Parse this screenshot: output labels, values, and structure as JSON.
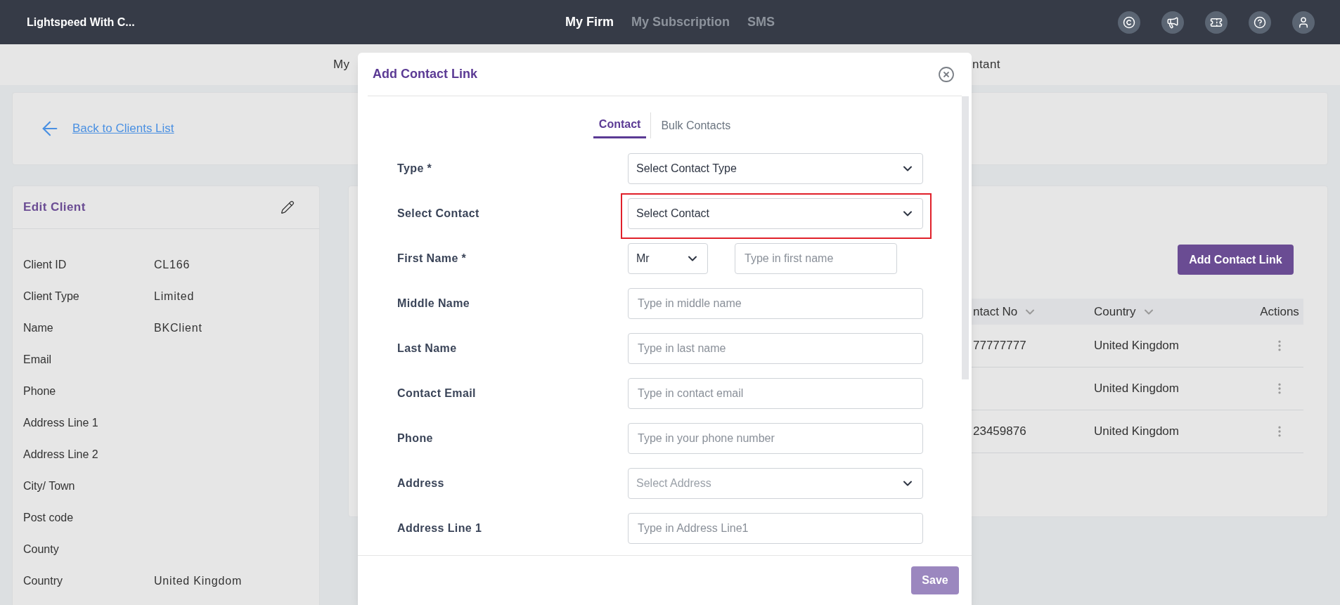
{
  "top_bar": {
    "brand": "Lightspeed With C...",
    "nav": [
      {
        "label": "My Firm",
        "selected": true
      },
      {
        "label": "My Subscription",
        "selected": false
      },
      {
        "label": "SMS",
        "selected": false
      }
    ]
  },
  "sub_nav": {
    "texts": [
      "My",
      "ntant"
    ]
  },
  "back_link": "Back to Clients List",
  "client_panel": {
    "title": "Edit Client",
    "fields": [
      {
        "label": "Client ID",
        "value": "CL166"
      },
      {
        "label": "Client Type",
        "value": "Limited"
      },
      {
        "label": "Name",
        "value": "BKClient"
      },
      {
        "label": "Email"
      },
      {
        "label": "Phone"
      },
      {
        "label": "Address Line 1"
      },
      {
        "label": "Address Line 2"
      },
      {
        "label": "City/ Town"
      },
      {
        "label": "Post code"
      },
      {
        "label": "County"
      },
      {
        "label": "Country",
        "value": "United Kingdom"
      }
    ]
  },
  "contacts_panel": {
    "add_button": "Add Contact Link",
    "columns": [
      {
        "label": "ntact No",
        "sortable": true
      },
      {
        "label": "Country",
        "sortable": true
      },
      {
        "label": "Actions",
        "sortable": false
      }
    ],
    "rows": [
      [
        "77777777",
        "United Kingdom"
      ],
      [
        "",
        "United Kingdom"
      ],
      [
        "23459876",
        "United Kingdom"
      ]
    ]
  },
  "modal": {
    "title": "Add Contact Link",
    "tabs": [
      {
        "label": "Contact",
        "selected": true
      },
      {
        "label": "Bulk Contacts",
        "selected": false
      }
    ],
    "fields": [
      {
        "label": "Type *",
        "kind": "select",
        "value": "Select Contact Type",
        "highlighted": false
      },
      {
        "label": "Select Contact",
        "kind": "select",
        "value": "Select Contact",
        "highlighted": true
      },
      {
        "label": "First Name *",
        "kind": "name",
        "title": "Mr",
        "placeholder": "Type in first name",
        "highlighted": false
      },
      {
        "label": "Middle Name",
        "kind": "input",
        "placeholder": "Type in middle name",
        "highlighted": false
      },
      {
        "label": "Last Name",
        "kind": "input",
        "placeholder": "Type in last name",
        "highlighted": false
      },
      {
        "label": "Contact Email",
        "kind": "input",
        "placeholder": "Type in contact email",
        "highlighted": false
      },
      {
        "label": "Phone",
        "kind": "input",
        "placeholder": "Type in your phone number",
        "highlighted": false
      },
      {
        "label": "Address",
        "kind": "select",
        "placeholder": "Select Address",
        "highlighted": false
      },
      {
        "label": "Address Line 1",
        "kind": "input",
        "placeholder": "Type in Address Line1",
        "highlighted": false
      }
    ],
    "save_button": {
      "label": "Save",
      "disabled": true
    }
  }
}
